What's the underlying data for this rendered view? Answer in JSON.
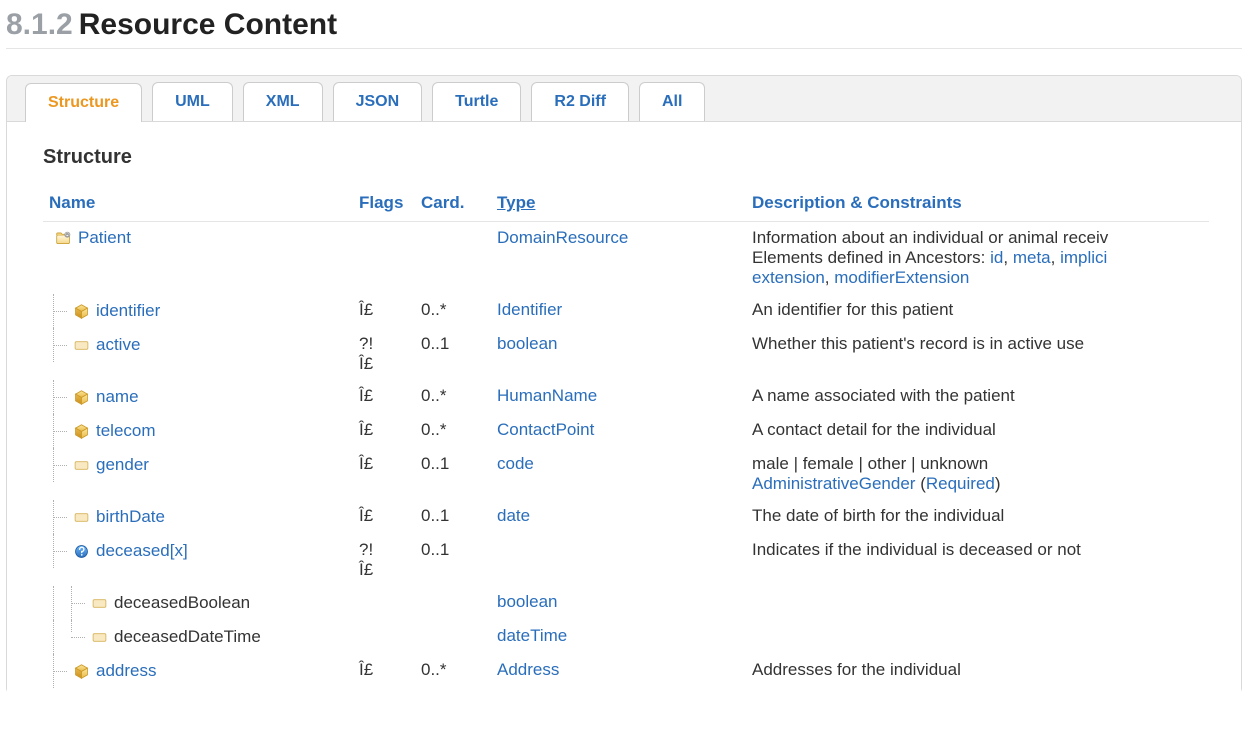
{
  "heading": {
    "number": "8.1.2",
    "title": "Resource Content"
  },
  "tabs": [
    {
      "label": "Structure",
      "active": true
    },
    {
      "label": "UML",
      "active": false
    },
    {
      "label": "XML",
      "active": false
    },
    {
      "label": "JSON",
      "active": false
    },
    {
      "label": "Turtle",
      "active": false
    },
    {
      "label": "R2 Diff",
      "active": false
    },
    {
      "label": "All",
      "active": false
    }
  ],
  "section_title": "Structure",
  "columns": {
    "name": "Name",
    "flags": "Flags",
    "card": "Card.",
    "type": "Type",
    "desc": "Description & Constraints"
  },
  "rows": [
    {
      "depth": 0,
      "branch": "",
      "icon": "folder",
      "name": "Patient",
      "name_link": true,
      "flags": "",
      "card": "",
      "type": {
        "text": "DomainResource",
        "link": true
      },
      "desc": {
        "text_pre": "Information about an individual or animal receiv",
        "ancestors_label": "Elements defined in Ancestors: ",
        "ancestors": [
          "id",
          "meta",
          "implici"
        ],
        "ancestors2": [
          "extension",
          "modifierExtension"
        ]
      }
    },
    {
      "depth": 1,
      "branch": "tee",
      "icon": "cube",
      "name": "identifier",
      "name_link": true,
      "flags": "Î£",
      "card": "0..*",
      "type": {
        "text": "Identifier",
        "link": true
      },
      "desc": {
        "text_pre": "An identifier for this patient"
      }
    },
    {
      "depth": 1,
      "branch": "tee",
      "icon": "prim",
      "name": "active",
      "name_link": true,
      "flags": "?!\nÎ£",
      "card": "0..1",
      "type": {
        "text": "boolean",
        "link": true
      },
      "desc": {
        "text_pre": "Whether this patient's record is in active use"
      }
    },
    {
      "depth": 1,
      "branch": "tee",
      "icon": "cube",
      "name": "name",
      "name_link": true,
      "flags": "Î£",
      "card": "0..*",
      "type": {
        "text": "HumanName",
        "link": true
      },
      "desc": {
        "text_pre": "A name associated with the patient"
      }
    },
    {
      "depth": 1,
      "branch": "tee",
      "icon": "cube",
      "name": "telecom",
      "name_link": true,
      "flags": "Î£",
      "card": "0..*",
      "type": {
        "text": "ContactPoint",
        "link": true
      },
      "desc": {
        "text_pre": "A contact detail for the individual"
      }
    },
    {
      "depth": 1,
      "branch": "tee",
      "icon": "prim",
      "name": "gender",
      "name_link": true,
      "flags": "Î£",
      "card": "0..1",
      "type": {
        "text": "code",
        "link": true
      },
      "desc": {
        "text_pre": "male | female | other | unknown",
        "binding_link": "AdministrativeGender",
        "binding_paren": " (",
        "binding_strength": "Required",
        "binding_close": ")"
      }
    },
    {
      "depth": 1,
      "branch": "tee",
      "icon": "prim",
      "name": "birthDate",
      "name_link": true,
      "flags": "Î£",
      "card": "0..1",
      "type": {
        "text": "date",
        "link": true
      },
      "desc": {
        "text_pre": "The date of birth for the individual"
      }
    },
    {
      "depth": 1,
      "branch": "tee",
      "icon": "choice",
      "name": "deceased[x]",
      "name_link": true,
      "flags": "?!\nÎ£",
      "card": "0..1",
      "type": {
        "text": "",
        "link": false
      },
      "desc": {
        "text_pre": "Indicates if the individual is deceased or not"
      }
    },
    {
      "depth": 2,
      "branch": "tee",
      "icon": "prim",
      "name": "deceasedBoolean",
      "name_link": false,
      "flags": "",
      "card": "",
      "type": {
        "text": "boolean",
        "link": true
      },
      "desc": {
        "text_pre": ""
      }
    },
    {
      "depth": 2,
      "branch": "elbow",
      "icon": "prim",
      "name": "deceasedDateTime",
      "name_link": false,
      "flags": "",
      "card": "",
      "type": {
        "text": "dateTime",
        "link": true
      },
      "desc": {
        "text_pre": ""
      }
    },
    {
      "depth": 1,
      "branch": "tee",
      "icon": "cube",
      "name": "address",
      "name_link": true,
      "flags": "Î£",
      "card": "0..*",
      "type": {
        "text": "Address",
        "link": true
      },
      "desc": {
        "text_pre": "Addresses for the individual"
      }
    }
  ]
}
